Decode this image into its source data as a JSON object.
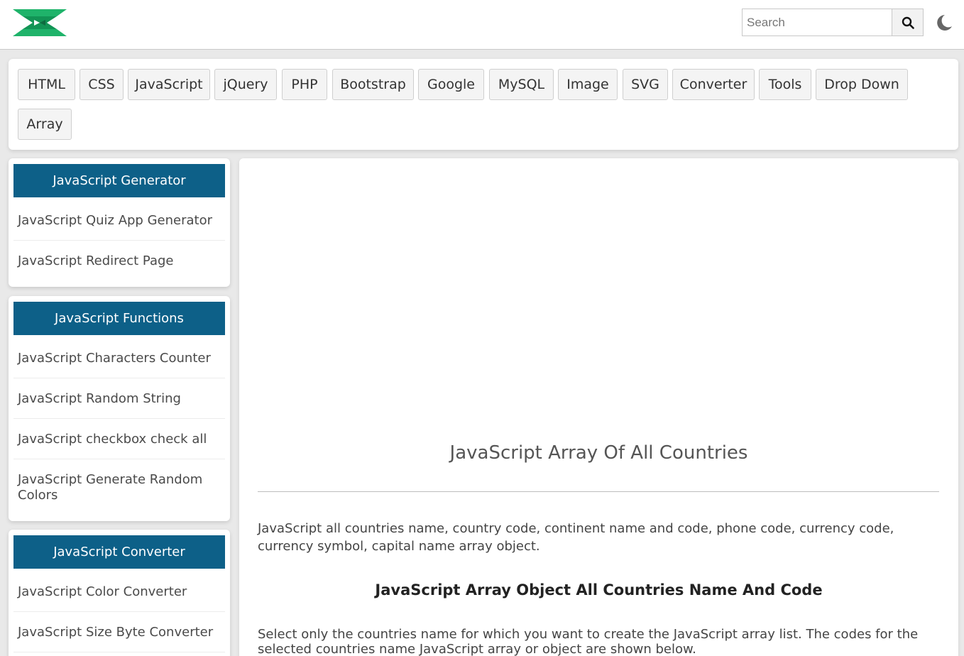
{
  "header": {
    "search": {
      "placeholder": "Search",
      "value": ""
    }
  },
  "nav": {
    "items": [
      "HTML",
      "CSS",
      "JavaScript",
      "jQuery",
      "PHP",
      "Bootstrap",
      "Google",
      "MySQL",
      "Image",
      "SVG",
      "Converter",
      "Tools",
      "Drop Down",
      "Array"
    ]
  },
  "sidebar": {
    "sections": [
      {
        "title": "JavaScript Generator",
        "items": [
          "JavaScript Quiz App Generator",
          "JavaScript Redirect Page"
        ]
      },
      {
        "title": "JavaScript Functions",
        "items": [
          "JavaScript Characters Counter",
          "JavaScript Random String",
          "JavaScript checkbox check all",
          "JavaScript Generate Random Colors"
        ]
      },
      {
        "title": "JavaScript Converter",
        "items": [
          "JavaScript Color Converter",
          "JavaScript Size Byte Converter"
        ]
      }
    ]
  },
  "main": {
    "title": "JavaScript Array Of All Countries",
    "intro": "JavaScript all countries name, country code, continent name and code, phone code, currency code, currency symbol, capital name array object.",
    "section_heading": "JavaScript Array Object All Countries Name And Code",
    "instructions": "Select only the countries name for which you want to create the JavaScript array list. The codes for the selected countries name JavaScript array or object are shown below."
  },
  "colors": {
    "accent": "#0d6088",
    "logo_green": "#22b36a",
    "logo_dark": "#0e6b40"
  },
  "icons": {
    "search": "search-icon",
    "theme": "moon-icon",
    "logo": "logo-icon"
  }
}
